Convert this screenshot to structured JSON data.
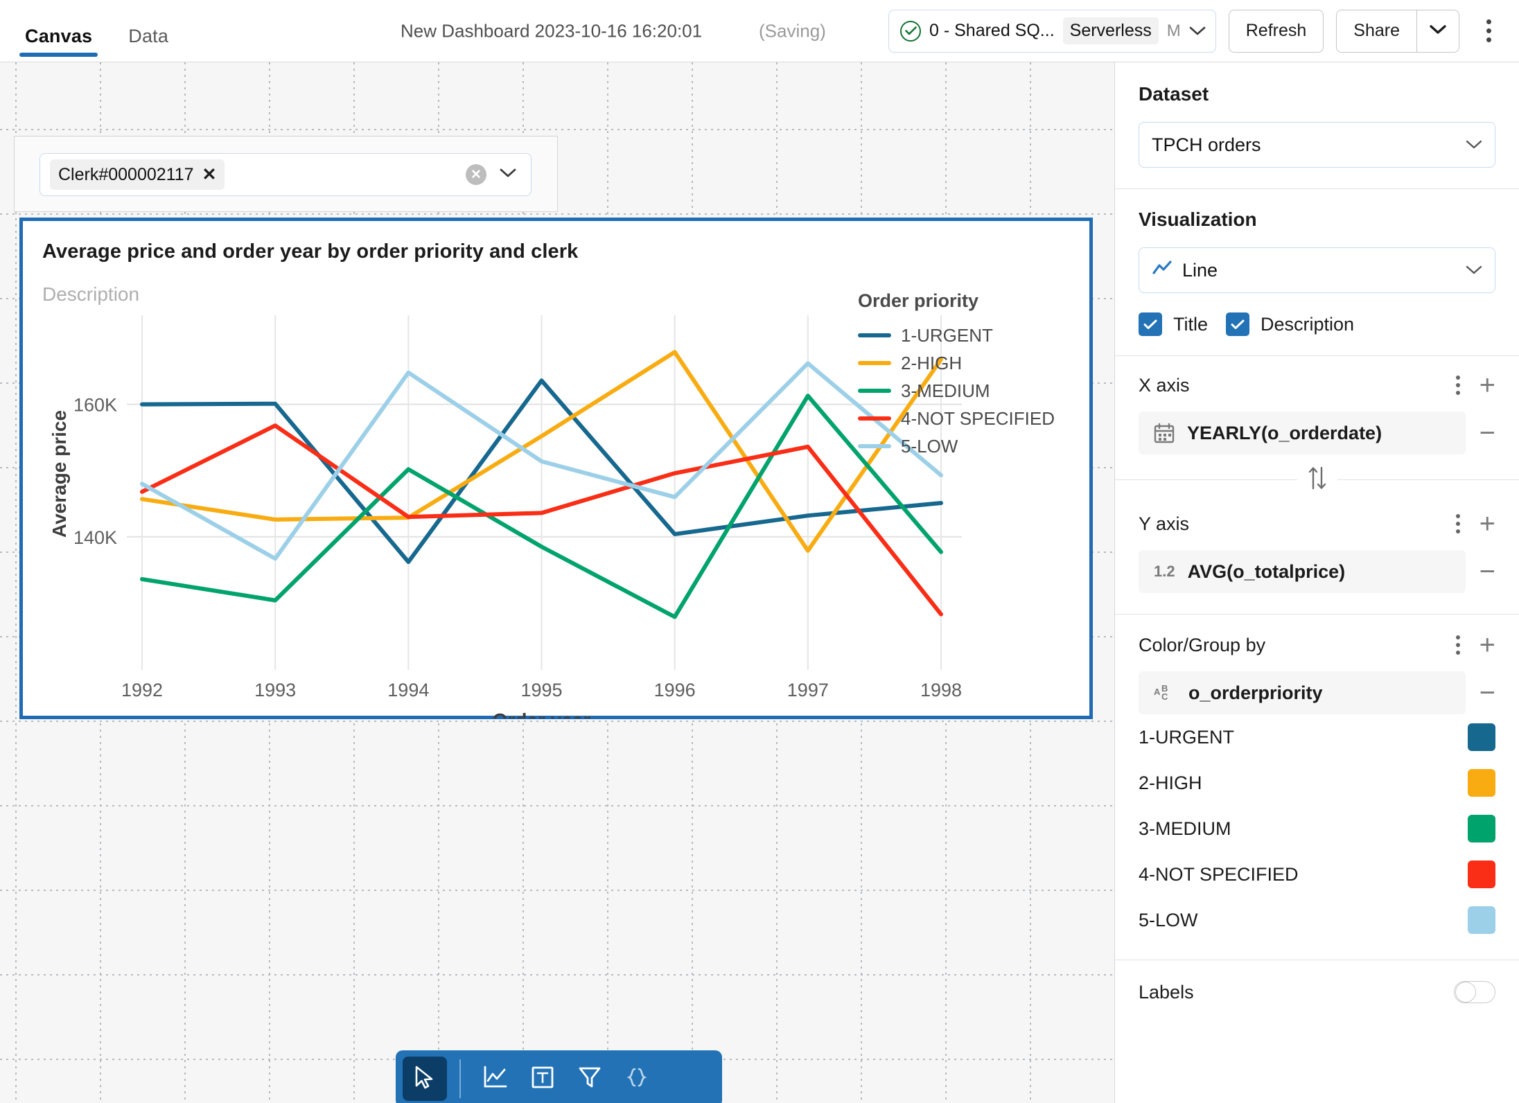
{
  "topbar": {
    "tabs": [
      {
        "label": "Canvas",
        "active": true
      },
      {
        "label": "Data",
        "active": false
      }
    ],
    "doc_title": "New Dashboard 2023-10-16 16:20:01",
    "saving_status": "(Saving)",
    "compute": {
      "name": "0 - Shared SQ...",
      "type_chip": "Serverless",
      "size": "M"
    },
    "refresh_label": "Refresh",
    "share_label": "Share",
    "more_menu": "kebab-menu"
  },
  "filter_widget": {
    "token_label": "Clerk#000002117",
    "token_remove": "✕",
    "clear_label": "✕"
  },
  "chart_card": {
    "title": "Average price and order year by order priority and clerk",
    "description_placeholder": "Description"
  },
  "chart_data": {
    "type": "line",
    "title": "Average price and order year by order priority and clerk",
    "xlabel": "Order year",
    "ylabel": "Average price",
    "legend_title": "Order priority",
    "legend_position": "right",
    "grid": true,
    "x": [
      1992,
      1993,
      1994,
      1995,
      1996,
      1997,
      1998
    ],
    "xtick_labels": [
      "1992",
      "1993",
      "1994",
      "1995",
      "1996",
      "1997",
      "1998"
    ],
    "ytick_labels": [
      "140K",
      "160K"
    ],
    "yticks": [
      140000,
      160000
    ],
    "ylim": [
      127000,
      172000
    ],
    "series": [
      {
        "name": "1-URGENT",
        "color": "#16688f",
        "values": [
          160000,
          160100,
          136200,
          163600,
          140400,
          143200,
          145100
        ]
      },
      {
        "name": "2-HIGH",
        "color": "#f8ac12",
        "values": [
          145700,
          142600,
          142900,
          155200,
          167900,
          137900,
          166800
        ]
      },
      {
        "name": "3-MEDIUM",
        "color": "#00a36c",
        "values": [
          133600,
          130400,
          150200,
          138500,
          127900,
          161300,
          137700
        ]
      },
      {
        "name": "4-NOT SPECIFIED",
        "color": "#fa2d16",
        "values": [
          146800,
          156800,
          143000,
          143600,
          149600,
          153600,
          128300
        ]
      },
      {
        "name": "5-LOW",
        "color": "#9cd0e8",
        "values": [
          148000,
          136700,
          164800,
          151400,
          146000,
          166200,
          149300
        ]
      }
    ]
  },
  "canvas_toolbar": {
    "tools": [
      {
        "name": "pointer-tool",
        "icon": "cursor-icon",
        "active": true
      },
      {
        "name": "chart-tool",
        "icon": "line-chart-icon",
        "active": false
      },
      {
        "name": "text-tool",
        "icon": "text-box-icon",
        "active": false
      },
      {
        "name": "filter-tool",
        "icon": "funnel-icon",
        "active": false
      },
      {
        "name": "code-tool",
        "icon": "braces-icon",
        "active": false
      }
    ]
  },
  "panel": {
    "dataset": {
      "heading": "Dataset",
      "value": "TPCH orders"
    },
    "visualization": {
      "heading": "Visualization",
      "value": "Line"
    },
    "display_toggles": [
      {
        "label": "Title",
        "checked": true
      },
      {
        "label": "Description",
        "checked": true
      }
    ],
    "x_axis": {
      "heading": "X axis",
      "field": "YEARLY(o_orderdate)",
      "icon": "calendar-icon"
    },
    "swap_icon": "swap-vertical-icon",
    "y_axis": {
      "heading": "Y axis",
      "field": "AVG(o_totalprice)",
      "icon": "1.2"
    },
    "color_group": {
      "heading": "Color/Group by",
      "field": "o_orderpriority",
      "icon": "abc-icon",
      "items": [
        {
          "label": "1-URGENT",
          "color": "#16688f"
        },
        {
          "label": "2-HIGH",
          "color": "#f8ac12"
        },
        {
          "label": "3-MEDIUM",
          "color": "#00a36c"
        },
        {
          "label": "4-NOT SPECIFIED",
          "color": "#fa2d16"
        },
        {
          "label": "5-LOW",
          "color": "#9cd0e8"
        }
      ]
    },
    "labels": {
      "label": "Labels",
      "on": false
    }
  }
}
